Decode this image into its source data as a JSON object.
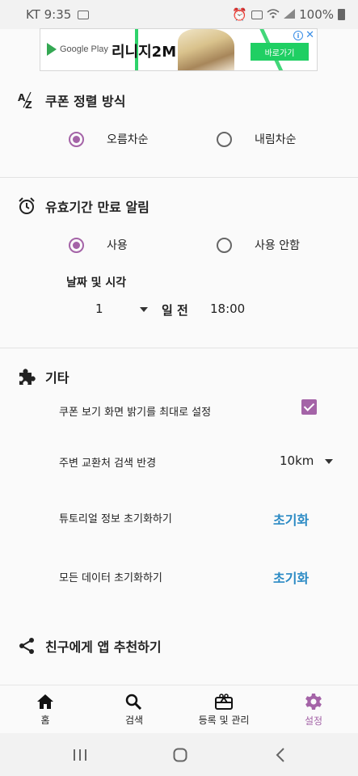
{
  "status_bar": {
    "carrier_time": "KT 9:35",
    "battery": "100%"
  },
  "ad": {
    "store": "Google Play",
    "title": "리니지2M",
    "cta": "바로가기",
    "info": "i",
    "close": "✕"
  },
  "sort": {
    "title": "쿠폰 정렬 방식",
    "options": [
      "오름차순",
      "내림차순"
    ],
    "selected": "오름차순"
  },
  "expiry": {
    "title": "유효기간 만료 알림",
    "options": [
      "사용",
      "사용 안함"
    ],
    "selected": "사용",
    "datetime_label": "날짜 및 시각",
    "days_value": "1",
    "days_suffix": "일 전",
    "time": "18:00"
  },
  "misc": {
    "title": "기타",
    "brightness_label": "쿠폰 보기 화면 밝기를 최대로 설정",
    "brightness_checked": true,
    "search_radius_label": "주변 교환처 검색 반경",
    "search_radius_value": "10km",
    "tutorial_reset_label": "튜토리얼 정보 초기화하기",
    "tutorial_reset_button": "초기화",
    "data_reset_label": "모든 데이터 초기화하기",
    "data_reset_button": "초기화"
  },
  "share": {
    "title": "친구에게 앱 추천하기"
  },
  "bottom_nav": [
    {
      "label": "홈",
      "icon": "home-icon"
    },
    {
      "label": "검색",
      "icon": "search-icon"
    },
    {
      "label": "등록 및 관리",
      "icon": "gift-card-icon"
    },
    {
      "label": "설정",
      "icon": "gear-icon",
      "active": true
    }
  ],
  "colors": {
    "accent": "#a463a7",
    "link": "#2a8ac4",
    "ad_green": "#1fcf63"
  }
}
